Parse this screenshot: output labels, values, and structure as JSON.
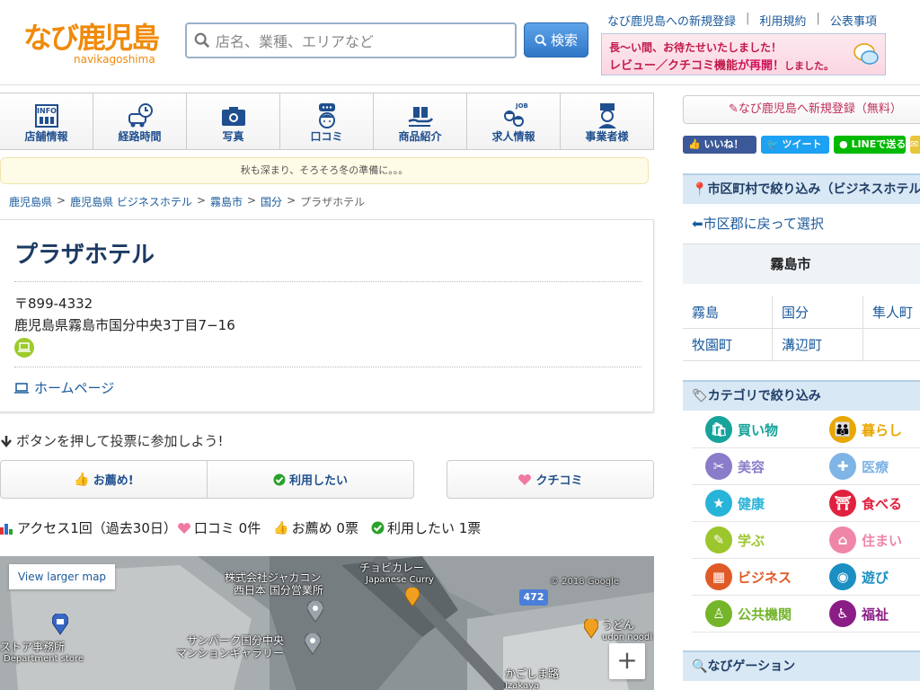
{
  "header": {
    "logo_text": "なび鹿児島",
    "logo_sub": "navikagoshima",
    "search_placeholder": "店名、業種、エリアなど",
    "search_button": "検索",
    "links": [
      "なび鹿児島への新規登録",
      "利用規約",
      "公表事項"
    ],
    "banner_line1": "長〜い間、お待たせいたしました！",
    "banner_line2_a": "レビュー／クチコミ機能",
    "banner_line2_b": "が再開！",
    "banner_line2_c": "しました。"
  },
  "tabs": [
    {
      "label": "店舗情報",
      "icon": "info-building-icon"
    },
    {
      "label": "経路時間",
      "icon": "car-clock-icon"
    },
    {
      "label": "写真",
      "icon": "camera-icon"
    },
    {
      "label": "口コミ",
      "icon": "speech-person-icon"
    },
    {
      "label": "商品紹介",
      "icon": "gift-hand-icon"
    },
    {
      "label": "求人情報",
      "icon": "job-people-icon"
    },
    {
      "label": "事業者様",
      "icon": "business-person-icon"
    }
  ],
  "tab_icon_texts": {
    "info": "INFO",
    "job": "JOB"
  },
  "notice": "秋も深まり、そろそろ冬の準備に。。。",
  "breadcrumb": [
    "鹿児島県",
    "鹿児島県 ビジネスホテル",
    "霧島市",
    "国分",
    "プラザホテル"
  ],
  "shop": {
    "name": "プラザホテル",
    "postal": "〒899-4332",
    "address": "鹿児島県霧島市国分中央3丁目7−16",
    "homepage": "ホームページ"
  },
  "vote": {
    "hint": "ボタンを押して投票に参加しよう!",
    "recommend": "お薦め!",
    "want": "利用したい",
    "kuchikomi": "クチコミ"
  },
  "stats": {
    "access": "アクセス1回（過去30日）",
    "kuchikomi": "口コミ 0件",
    "recommend": "お薦め 0票",
    "want": "利用したい 1票"
  },
  "map": {
    "larger": "View larger map",
    "zoom_in": "+",
    "labels": {
      "choby": "チョビカレー",
      "choby_en": "Japanese Curry",
      "company1": "株式会社ジャカコン",
      "company2": "西日本 国分営業所",
      "sunpark1": "サンパーク国分中央",
      "sunpark2": "マンションギャラリー",
      "store": "ストア事務所",
      "store_en": "Department store",
      "road": "472",
      "udon": "うどん",
      "udon_en": "udon noodl",
      "kagoshima": "かごしま路",
      "izakaya": "Izakaya",
      "watermark": "© 2018 Google"
    }
  },
  "sidebar": {
    "signup": "なび鹿児島へ新規登録（無料）",
    "social": {
      "fb": "いいね！",
      "tw": "ツイート",
      "line": "LINEで送る"
    },
    "area_title": "市区町村で絞り込み（ビジネスホテル）",
    "back": "⬅市区郡に戻って選択",
    "city": "霧島市",
    "towns": [
      "霧島",
      "国分",
      "隼人町",
      "牧園町",
      "溝辺町"
    ],
    "category_title": "カテゴリで絞り込み",
    "categories": [
      {
        "label": "買い物",
        "color": "#15a39a"
      },
      {
        "label": "暮らし",
        "color": "#e8a800"
      },
      {
        "label": "美容",
        "color": "#8a7cc9"
      },
      {
        "label": "医療",
        "color": "#7fb4e6"
      },
      {
        "label": "健康",
        "color": "#28b3d8"
      },
      {
        "label": "食べる",
        "color": "#e0213f"
      },
      {
        "label": "学ぶ",
        "color": "#9bc62c"
      },
      {
        "label": "住まい",
        "color": "#ef86a8"
      },
      {
        "label": "ビジネス",
        "color": "#e05a28"
      },
      {
        "label": "遊び",
        "color": "#1b8fc2"
      },
      {
        "label": "公共機関",
        "color": "#74b52a"
      },
      {
        "label": "福祉",
        "color": "#8a1e86"
      }
    ],
    "navigation_title": "なびゲーション"
  }
}
